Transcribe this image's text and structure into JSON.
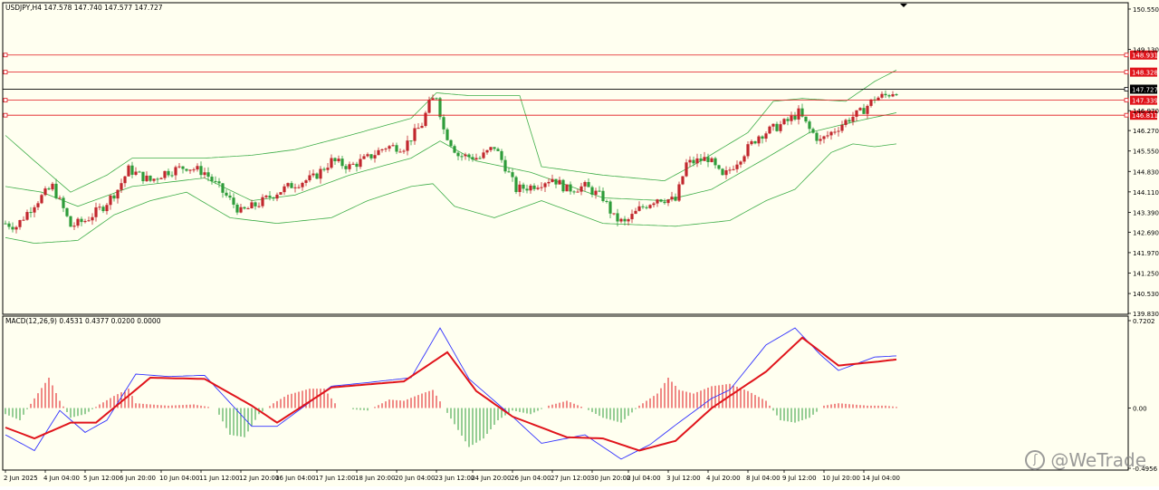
{
  "header": {
    "symbol_info": "USDJPY,H4  147.578 147.740 147.577 147.727",
    "macd_info": "MACD(12,26,9) 0.4531 0.4377 0.0200 0.0000"
  },
  "watermark": {
    "text": "@WeTrade",
    "logo_icon": "wetrade-logo-icon"
  },
  "colors": {
    "background": "#fffff0",
    "bull": "#c1272d",
    "bear": "#2e9c3a",
    "bands": "#3fae49",
    "level_lines": "#e0141b",
    "macd_line": "#3333ff",
    "signal_line": "#e0141b",
    "hist_pos": "#e0141b",
    "hist_neg": "#2e9c3a"
  },
  "chart_data": [
    {
      "type": "candlestick",
      "title": "USDJPY,H4",
      "ylim": [
        139.83,
        150.55
      ],
      "yticks": [
        "150.550",
        "149.130",
        "148.931",
        "148.328",
        "147.727",
        "147.339",
        "146.970",
        "146.811",
        "146.270",
        "145.550",
        "144.830",
        "144.110",
        "143.390",
        "142.690",
        "141.970",
        "141.250",
        "140.530",
        "139.830"
      ],
      "xticks": [
        "2 Jun 2025",
        "4 Jun 04:00",
        "5 Jun 12:00",
        "6 Jun 20:00",
        "10 Jun 04:00",
        "11 Jun 12:00",
        "12 Jun 20:00",
        "16 Jun 04:00",
        "17 Jun 12:00",
        "18 Jun 20:00",
        "20 Jun 04:00",
        "23 Jun 12:00",
        "24 Jun 20:00",
        "26 Jun 04:00",
        "27 Jun 12:00",
        "30 Jun 20:00",
        "2 Jul 04:00",
        "3 Jul 12:00",
        "4 Jul 20:00",
        "8 Jul 04:00",
        "9 Jul 12:00",
        "10 Jul 20:00",
        "14 Jul 04:00"
      ],
      "levels": [
        148.931,
        148.328,
        147.727,
        147.339,
        146.811
      ],
      "level_labels": [
        "148.931",
        "148.328",
        "147.727",
        "147.339",
        "146.811"
      ],
      "current_price": 147.727,
      "grid": false,
      "anchors": [
        [
          0,
          143.0
        ],
        [
          3,
          142.9
        ],
        [
          8,
          143.7
        ],
        [
          13,
          144.3
        ],
        [
          16,
          143.5
        ],
        [
          18,
          142.9
        ],
        [
          22,
          143.1
        ],
        [
          27,
          143.6
        ],
        [
          31,
          144.2
        ],
        [
          34,
          144.9
        ],
        [
          40,
          144.5
        ],
        [
          44,
          144.8
        ],
        [
          50,
          145.0
        ],
        [
          55,
          144.8
        ],
        [
          60,
          144.1
        ],
        [
          65,
          143.4
        ],
        [
          70,
          143.7
        ],
        [
          75,
          144.1
        ],
        [
          80,
          144.4
        ],
        [
          85,
          144.6
        ],
        [
          90,
          145.2
        ],
        [
          95,
          145.0
        ],
        [
          100,
          145.3
        ],
        [
          105,
          145.7
        ],
        [
          110,
          145.7
        ],
        [
          115,
          146.5
        ],
        [
          117,
          147.2
        ],
        [
          119,
          147.5
        ],
        [
          121,
          146.3
        ],
        [
          125,
          145.4
        ],
        [
          131,
          145.3
        ],
        [
          135,
          145.7
        ],
        [
          138,
          145.0
        ],
        [
          141,
          144.2
        ],
        [
          145,
          144.3
        ],
        [
          151,
          144.6
        ],
        [
          155,
          144.2
        ],
        [
          160,
          144.3
        ],
        [
          165,
          143.9
        ],
        [
          168,
          143.2
        ],
        [
          171,
          143.0
        ],
        [
          175,
          143.5
        ],
        [
          180,
          143.9
        ],
        [
          185,
          143.8
        ],
        [
          188,
          145.1
        ],
        [
          194,
          145.3
        ],
        [
          198,
          144.6
        ],
        [
          204,
          145.5
        ],
        [
          208,
          146.1
        ],
        [
          213,
          146.4
        ],
        [
          216,
          146.6
        ],
        [
          219,
          146.9
        ],
        [
          222,
          146.3
        ],
        [
          225,
          145.9
        ],
        [
          229,
          146.3
        ],
        [
          233,
          146.7
        ],
        [
          236,
          146.9
        ],
        [
          240,
          147.4
        ],
        [
          243,
          147.5
        ],
        [
          246,
          147.7
        ]
      ],
      "bollinger": {
        "upper": [
          [
            0,
            146.1
          ],
          [
            8,
            145.2
          ],
          [
            18,
            144.1
          ],
          [
            28,
            144.7
          ],
          [
            35,
            145.3
          ],
          [
            55,
            145.3
          ],
          [
            68,
            145.4
          ],
          [
            80,
            145.6
          ],
          [
            95,
            146.1
          ],
          [
            112,
            146.7
          ],
          [
            119,
            147.6
          ],
          [
            128,
            147.5
          ],
          [
            142,
            147.5
          ],
          [
            148,
            145.0
          ],
          [
            165,
            144.7
          ],
          [
            182,
            144.5
          ],
          [
            192,
            145.2
          ],
          [
            205,
            146.2
          ],
          [
            212,
            147.3
          ],
          [
            220,
            147.4
          ],
          [
            232,
            147.3
          ],
          [
            240,
            148.0
          ],
          [
            246,
            148.4
          ]
        ],
        "middle": [
          [
            0,
            144.3
          ],
          [
            10,
            144.1
          ],
          [
            20,
            143.6
          ],
          [
            35,
            144.3
          ],
          [
            55,
            144.6
          ],
          [
            68,
            143.8
          ],
          [
            80,
            144.0
          ],
          [
            95,
            144.7
          ],
          [
            112,
            145.3
          ],
          [
            120,
            145.9
          ],
          [
            130,
            145.2
          ],
          [
            145,
            144.8
          ],
          [
            165,
            143.9
          ],
          [
            182,
            143.8
          ],
          [
            195,
            144.2
          ],
          [
            210,
            145.3
          ],
          [
            222,
            146.2
          ],
          [
            235,
            146.6
          ],
          [
            246,
            146.9
          ]
        ],
        "lower": [
          [
            0,
            142.5
          ],
          [
            8,
            142.3
          ],
          [
            20,
            142.4
          ],
          [
            30,
            143.3
          ],
          [
            40,
            143.8
          ],
          [
            50,
            144.1
          ],
          [
            62,
            143.2
          ],
          [
            75,
            143.0
          ],
          [
            90,
            143.2
          ],
          [
            100,
            143.8
          ],
          [
            112,
            144.3
          ],
          [
            118,
            144.4
          ],
          [
            124,
            143.6
          ],
          [
            135,
            143.2
          ],
          [
            148,
            143.8
          ],
          [
            165,
            143.0
          ],
          [
            185,
            142.9
          ],
          [
            200,
            143.1
          ],
          [
            210,
            143.8
          ],
          [
            218,
            144.2
          ],
          [
            228,
            145.5
          ],
          [
            234,
            145.8
          ],
          [
            240,
            145.7
          ],
          [
            246,
            145.8
          ]
        ]
      }
    },
    {
      "type": "macd",
      "title": "MACD(12,26,9)",
      "ylim": [
        -0.4956,
        0.7202
      ],
      "yticks": [
        "0.7202",
        "0.00",
        "-0.4956"
      ],
      "series": [
        {
          "name": "MACD",
          "points": [
            [
              0,
              -0.22
            ],
            [
              8,
              -0.35
            ],
            [
              15,
              -0.02
            ],
            [
              22,
              -0.2
            ],
            [
              28,
              -0.1
            ],
            [
              36,
              0.28
            ],
            [
              45,
              0.26
            ],
            [
              55,
              0.27
            ],
            [
              68,
              -0.15
            ],
            [
              75,
              -0.15
            ],
            [
              90,
              0.18
            ],
            [
              100,
              0.21
            ],
            [
              112,
              0.25
            ],
            [
              120,
              0.66
            ],
            [
              128,
              0.24
            ],
            [
              140,
              -0.07
            ],
            [
              148,
              -0.29
            ],
            [
              160,
              -0.22
            ],
            [
              170,
              -0.42
            ],
            [
              178,
              -0.3
            ],
            [
              185,
              -0.14
            ],
            [
              195,
              0.08
            ],
            [
              200,
              0.15
            ],
            [
              210,
              0.52
            ],
            [
              218,
              0.66
            ],
            [
              225,
              0.44
            ],
            [
              230,
              0.31
            ],
            [
              240,
              0.42
            ],
            [
              246,
              0.43
            ]
          ]
        },
        {
          "name": "Signal",
          "points": [
            [
              0,
              -0.16
            ],
            [
              8,
              -0.25
            ],
            [
              18,
              -0.12
            ],
            [
              25,
              -0.12
            ],
            [
              40,
              0.25
            ],
            [
              55,
              0.24
            ],
            [
              68,
              0.02
            ],
            [
              75,
              -0.12
            ],
            [
              90,
              0.17
            ],
            [
              110,
              0.22
            ],
            [
              122,
              0.46
            ],
            [
              130,
              0.14
            ],
            [
              140,
              -0.07
            ],
            [
              155,
              -0.24
            ],
            [
              165,
              -0.25
            ],
            [
              175,
              -0.35
            ],
            [
              185,
              -0.27
            ],
            [
              195,
              0.0
            ],
            [
              210,
              0.3
            ],
            [
              220,
              0.58
            ],
            [
              230,
              0.35
            ],
            [
              240,
              0.38
            ],
            [
              246,
              0.4
            ]
          ]
        }
      ],
      "histogram": [
        [
          0,
          -0.05
        ],
        [
          4,
          -0.1
        ],
        [
          8,
          0.08
        ],
        [
          12,
          0.25
        ],
        [
          15,
          0.06
        ],
        [
          18,
          -0.08
        ],
        [
          22,
          -0.05
        ],
        [
          26,
          0.03
        ],
        [
          30,
          0.1
        ],
        [
          34,
          0.16
        ],
        [
          36,
          0.04
        ],
        [
          40,
          0.03
        ],
        [
          45,
          0.02
        ],
        [
          52,
          0.03
        ],
        [
          58,
          0.0
        ],
        [
          62,
          -0.22
        ],
        [
          66,
          -0.24
        ],
        [
          70,
          -0.05
        ],
        [
          74,
          0.04
        ],
        [
          78,
          0.11
        ],
        [
          84,
          0.16
        ],
        [
          88,
          0.16
        ],
        [
          92,
          0.0
        ],
        [
          100,
          -0.02
        ],
        [
          106,
          0.07
        ],
        [
          110,
          0.06
        ],
        [
          115,
          0.12
        ],
        [
          118,
          0.15
        ],
        [
          122,
          -0.04
        ],
        [
          128,
          -0.32
        ],
        [
          132,
          -0.25
        ],
        [
          136,
          -0.1
        ],
        [
          140,
          -0.02
        ],
        [
          145,
          -0.05
        ],
        [
          150,
          0.02
        ],
        [
          155,
          0.06
        ],
        [
          160,
          0.0
        ],
        [
          165,
          -0.08
        ],
        [
          170,
          -0.12
        ],
        [
          175,
          0.02
        ],
        [
          180,
          0.12
        ],
        [
          183,
          0.25
        ],
        [
          186,
          0.15
        ],
        [
          190,
          0.12
        ],
        [
          195,
          0.18
        ],
        [
          200,
          0.2
        ],
        [
          205,
          0.14
        ],
        [
          210,
          0.06
        ],
        [
          214,
          -0.1
        ],
        [
          218,
          -0.12
        ],
        [
          222,
          -0.08
        ],
        [
          226,
          0.02
        ],
        [
          230,
          0.04
        ],
        [
          234,
          0.03
        ],
        [
          238,
          0.02
        ],
        [
          243,
          0.02
        ],
        [
          246,
          0.01
        ]
      ]
    }
  ]
}
